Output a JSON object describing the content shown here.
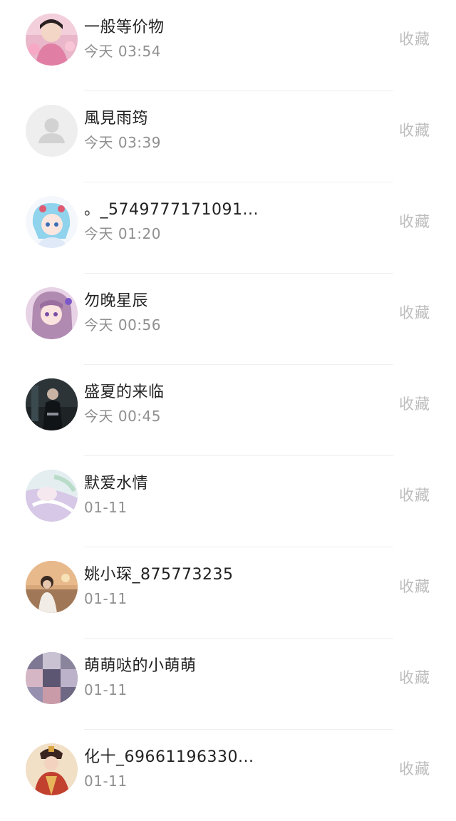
{
  "items": [
    {
      "name": "一般等价物",
      "time": "今天 03:54",
      "action": "收藏",
      "avatar": "avatar-photo-pink-icon"
    },
    {
      "name": "風見雨筠",
      "time": "今天 03:39",
      "action": "收藏",
      "avatar": "default-user-icon"
    },
    {
      "name": "。_5749777171091...",
      "time": "今天 01:20",
      "action": "收藏",
      "avatar": "avatar-anime-blue-icon"
    },
    {
      "name": "勿晚星辰",
      "time": "今天 00:56",
      "action": "收藏",
      "avatar": "avatar-anime-purple-icon"
    },
    {
      "name": "盛夏的来临",
      "time": "今天 00:45",
      "action": "收藏",
      "avatar": "avatar-dark-figure-icon"
    },
    {
      "name": "默爱水情",
      "time": "01-11",
      "action": "收藏",
      "avatar": "avatar-pastel-anime-icon"
    },
    {
      "name": "姚小琛_875773235",
      "time": "01-11",
      "action": "收藏",
      "avatar": "avatar-sunset-photo-icon"
    },
    {
      "name": "萌萌哒的小萌萌",
      "time": "01-11",
      "action": "收藏",
      "avatar": "avatar-blurred-photo-icon"
    },
    {
      "name": "化十_69661196330...",
      "time": "01-11",
      "action": "收藏",
      "avatar": "avatar-costume-photo-icon"
    }
  ]
}
